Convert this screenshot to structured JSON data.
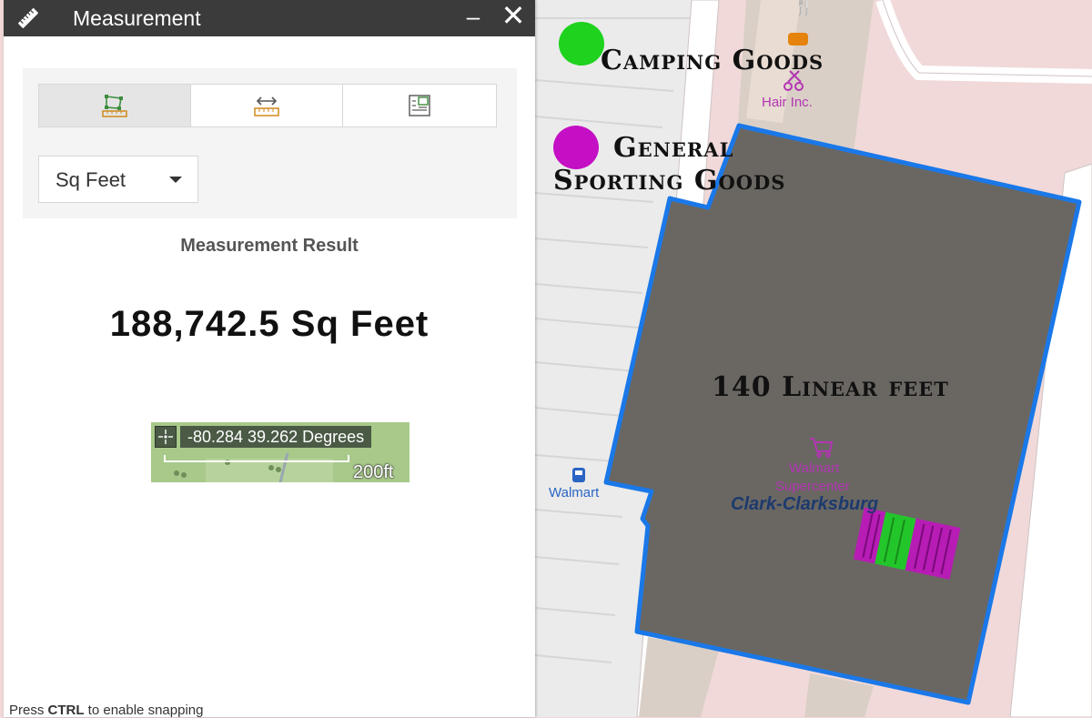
{
  "panel": {
    "title": "Measurement",
    "title_icon": "ruler-icon",
    "minimize_glyph": "–",
    "close_glyph": "✕",
    "tools": [
      {
        "name": "area-tool",
        "icon": "area-measure-icon",
        "active": true
      },
      {
        "name": "distance-tool",
        "icon": "distance-measure-icon",
        "active": false
      },
      {
        "name": "location-tool",
        "icon": "location-measure-icon",
        "active": false
      }
    ],
    "unit_selected": "Sq Feet",
    "result_label": "Measurement Result",
    "result_value": "188,742.5 Sq Feet",
    "coordinates": "-80.284 39.262 Degrees",
    "scale_label": "200ft",
    "snap_hint_prefix": "Press ",
    "snap_hint_key": "CTRL",
    "snap_hint_suffix": " to enable snapping"
  },
  "map": {
    "legend": [
      {
        "label": "Camping Goods",
        "color": "#1ed21e"
      },
      {
        "label_line1": "General",
        "label_line2": "Sporting Goods",
        "color": "#c40fc4"
      }
    ],
    "poi_hair": "Hair Inc.",
    "poi_walmart_bus": "Walmart",
    "store_name_line1": "Walmart",
    "store_name_line2": "Supercenter",
    "area_name": "Clark-Clarksburg",
    "linear_label": "140 Linear feet",
    "colors": {
      "building": "#6a6762",
      "outline": "#1a78e8",
      "road": "#ffffff",
      "road_edge": "#cfc3c3",
      "lot": "#ebebeb",
      "pink": "#f1d9d9"
    }
  }
}
